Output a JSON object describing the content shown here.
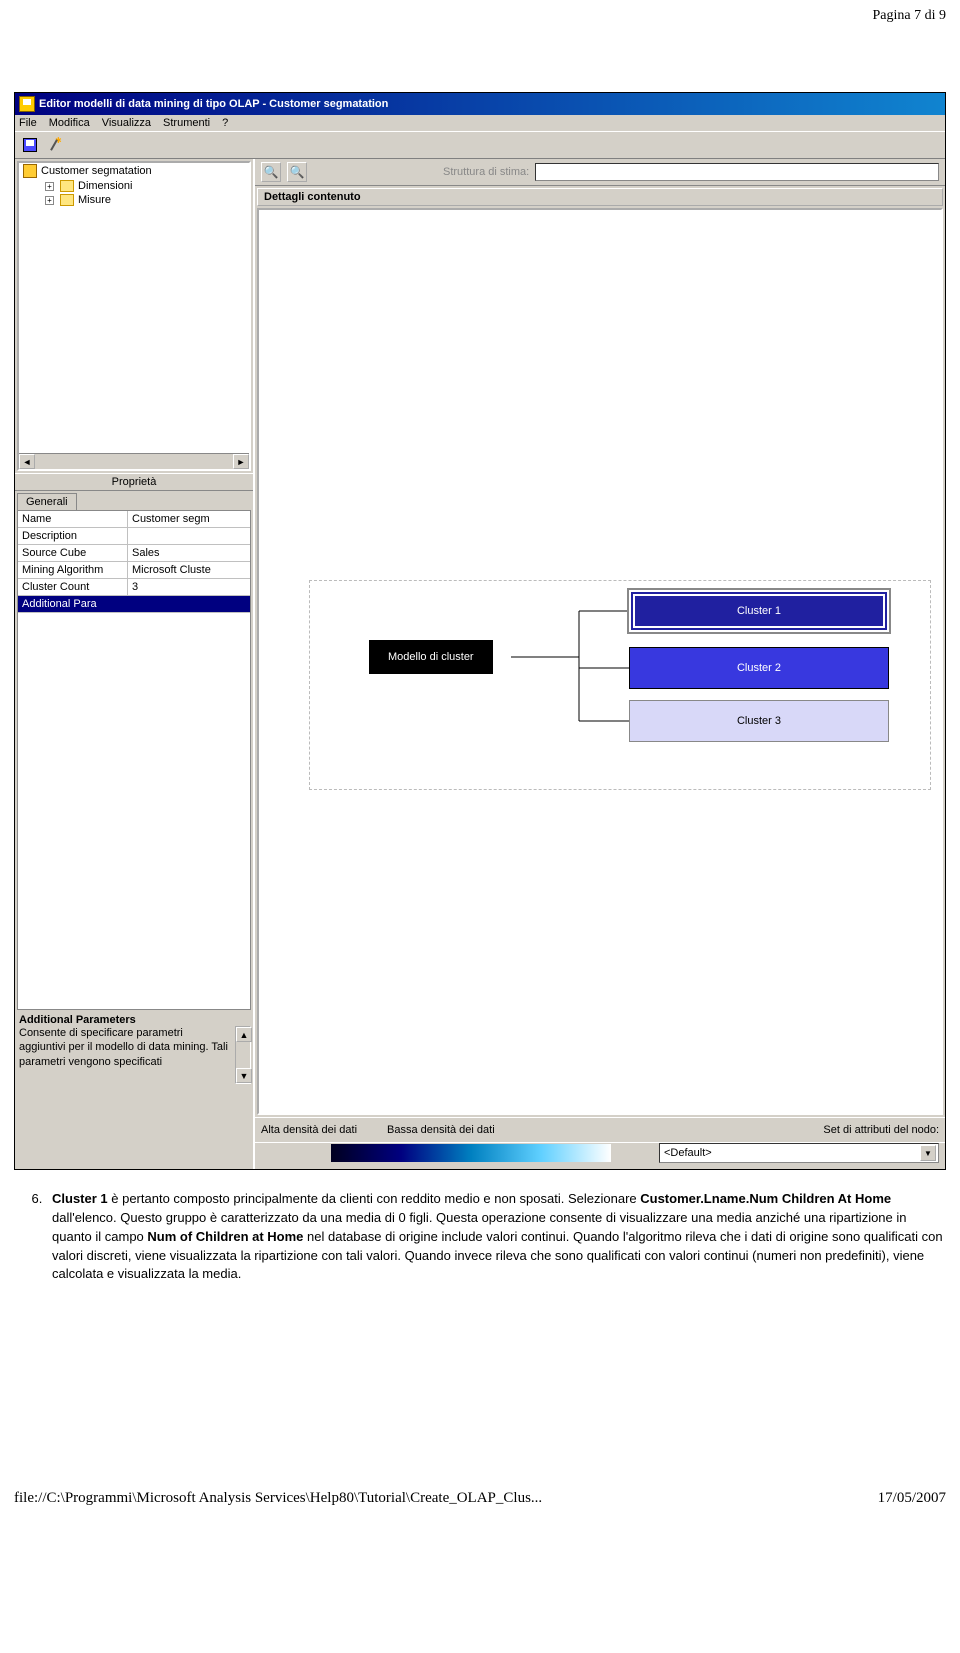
{
  "page_number": "Pagina 7 di 9",
  "window": {
    "title": "Editor modelli di data mining di tipo OLAP - Customer segmatation",
    "menu": [
      "File",
      "Modifica",
      "Visualizza",
      "Strumenti",
      "?"
    ]
  },
  "tree": {
    "root": "Customer segmatation",
    "children": [
      "Dimensioni",
      "Misure"
    ]
  },
  "properties": {
    "title": "Proprietà",
    "tab": "Generali",
    "rows": [
      {
        "k": "Name",
        "v": "Customer segm"
      },
      {
        "k": "Description",
        "v": ""
      },
      {
        "k": "Source Cube",
        "v": "Sales"
      },
      {
        "k": "Mining Algorithm",
        "v": "Microsoft Cluste"
      },
      {
        "k": "Cluster Count",
        "v": "3"
      },
      {
        "k": "Additional Para",
        "v": ""
      }
    ],
    "help_title": "Additional Parameters",
    "help_text": "Consente di specificare parametri aggiuntivi per il modello di data mining. Tali parametri vengono specificati"
  },
  "right": {
    "stima_label": "Struttura di stima:",
    "section": "Dettagli contenuto",
    "root_label": "Modello di cluster",
    "clusters": [
      "Cluster 1",
      "Cluster 2",
      "Cluster 3"
    ],
    "density_high": "Alta densità dei dati",
    "density_low": "Bassa densità dei dati",
    "nodo_label": "Set di attributi del nodo:",
    "nodo_value": "<Default>"
  },
  "doc": {
    "list_number": "6.",
    "bold1": "Cluster 1",
    "t1": " è pertanto composto principalmente da clienti con reddito medio e non sposati. Selezionare ",
    "bold2": "Customer.Lname.Num Children At Home",
    "t2": " dall'elenco. Questo gruppo è caratterizzato da una media di 0 figli. Questa operazione consente di visualizzare una media anziché una ripartizione in quanto il campo ",
    "bold3": "Num of Children at Home",
    "t3": " nel database di origine include valori continui. Quando l'algoritmo rileva che i dati di origine sono qualificati con valori discreti, viene visualizzata la ripartizione con tali valori. Quando invece rileva che sono qualificati con valori continui (numeri non predefiniti), viene calcolata e visualizzata la media."
  },
  "footer": {
    "path": "file://C:\\Programmi\\Microsoft Analysis Services\\Help80\\Tutorial\\Create_OLAP_Clus...",
    "date": "17/05/2007"
  }
}
